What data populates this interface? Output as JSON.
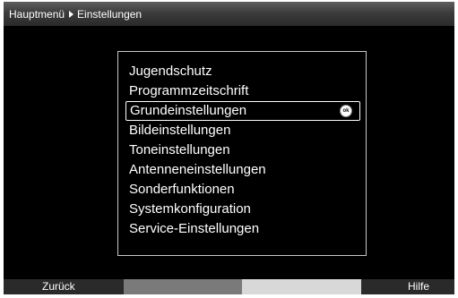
{
  "header": {
    "breadcrumb_root": "Hauptmenü",
    "breadcrumb_current": "Einstellungen"
  },
  "menu": {
    "items": [
      {
        "label": "Jugendschutz"
      },
      {
        "label": "Programmzeitschrift"
      },
      {
        "label": "Grundeinstellungen"
      },
      {
        "label": "Bildeinstellungen"
      },
      {
        "label": "Toneinstellungen"
      },
      {
        "label": "Antenneneinstellungen"
      },
      {
        "label": "Sonderfunktionen"
      },
      {
        "label": "Systemkonfiguration"
      },
      {
        "label": "Service-Einstellungen"
      }
    ],
    "selected_index": 2,
    "ok_icon_label": "ok"
  },
  "footer": {
    "back_label": "Zurück",
    "help_label": "Hilfe"
  },
  "colors": {
    "background": "#000000",
    "text": "#ffffff",
    "key_grey": "#7a7a7a",
    "key_light": "#d8d8d8"
  }
}
